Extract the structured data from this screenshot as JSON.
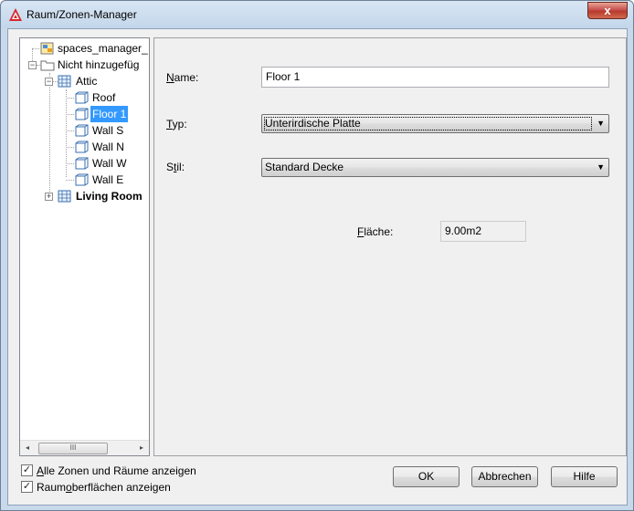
{
  "window": {
    "title": "Raum/Zonen-Manager",
    "close_glyph": "x"
  },
  "tree": {
    "items": [
      {
        "label": "spaces_manager_",
        "icon": "project-icon"
      },
      {
        "label": "Nicht hinzugefüg",
        "icon": "folder-icon",
        "expander": "−"
      },
      {
        "label": "Attic",
        "icon": "room-icon",
        "expander": "−"
      },
      {
        "label": "Roof",
        "icon": "surface-icon"
      },
      {
        "label": "Floor 1",
        "icon": "surface-icon",
        "selected": true
      },
      {
        "label": "Wall S",
        "icon": "surface-icon"
      },
      {
        "label": "Wall N",
        "icon": "surface-icon"
      },
      {
        "label": "Wall W",
        "icon": "surface-icon"
      },
      {
        "label": "Wall E",
        "icon": "surface-icon"
      },
      {
        "label": "Living Room",
        "icon": "room-icon",
        "expander": "+"
      }
    ],
    "scroll_thumb": "III",
    "scroll_left": "◂",
    "scroll_right": "▸"
  },
  "form": {
    "name_label_ul": "N",
    "name_label_rest": "ame:",
    "name_value": "Floor 1",
    "typ_label_ul": "T",
    "typ_label_rest": "yp:",
    "typ_value": "Unterirdische Platte",
    "stil_label_pre": "S",
    "stil_label_ul": "t",
    "stil_label_rest": "il:",
    "stil_value": "Standard Decke",
    "flaeche_label_ul": "F",
    "flaeche_label_rest": "läche:",
    "flaeche_value": "9.00m2",
    "dropdown_glyph": "▼"
  },
  "options": {
    "show_all_ul": "A",
    "show_all_rest": "lle Zonen und Räume anzeigen",
    "show_all_checked": true,
    "show_surfaces_pre": "Raum",
    "show_surfaces_ul": "o",
    "show_surfaces_rest": "berflächen anzeigen",
    "show_surfaces_checked": true,
    "check_glyph": "✓"
  },
  "buttons": {
    "ok": "OK",
    "cancel": "Abbrechen",
    "help": "Hilfe"
  },
  "colors": {
    "selection": "#3399ff",
    "window_frame": "#c8d9ec",
    "close_button": "#c75050"
  }
}
